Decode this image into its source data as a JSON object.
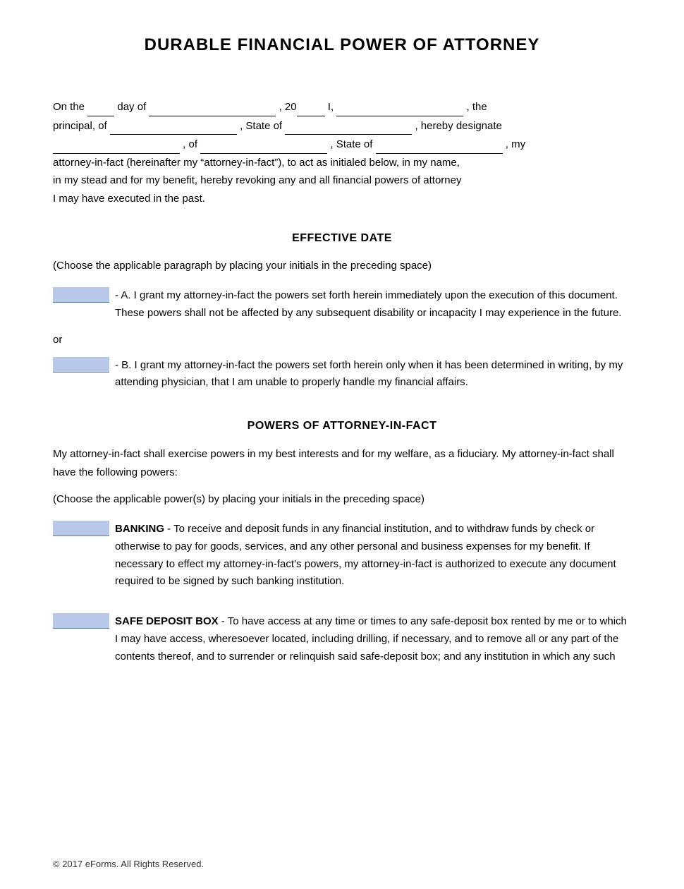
{
  "title": "DURABLE FINANCIAL POWER OF ATTORNEY",
  "intro": {
    "line1_pre": "On the",
    "day_field": "",
    "line1_mid1": "day of",
    "month_field": "",
    "line1_mid2": ", 20",
    "year_field": "",
    "line1_mid3": "I,",
    "name_field": "",
    "line1_end": ", the",
    "line2_pre": "principal, of",
    "address_field": "",
    "line2_mid": ", State of",
    "state1_field": "",
    "line2_end": ", hereby designate",
    "line3_name_field": "",
    "line3_mid1": ", of",
    "line3_address_field": "",
    "line3_mid2": ", State of",
    "line3_state_field": "",
    "line3_end": ", my",
    "line4": "attorney-in-fact (hereinafter my “attorney-in-fact”), to act as initialed below, in my name,",
    "line5": "in my stead and for my benefit, hereby revoking any and all financial powers of attorney",
    "line6": "I may have executed in the past."
  },
  "effective_date": {
    "section_title": "EFFECTIVE DATE",
    "choose_note": "(Choose the applicable paragraph by placing your initials in the preceding space)",
    "option_a": {
      "initials_label": "",
      "text": "- A. I grant my attorney-in-fact the powers set forth herein immediately upon the execution of this document. These powers shall not be affected by any subsequent disability or incapacity I may experience in the future."
    },
    "or_text": "or",
    "option_b": {
      "initials_label": "",
      "text": "- B. I grant my attorney-in-fact the powers set forth herein only when it has been determined in writing, by my attending physician, that I am unable to properly handle my financial affairs."
    }
  },
  "powers_of_attorney": {
    "section_title": "POWERS OF ATTORNEY-IN-FACT",
    "intro1": "My attorney-in-fact shall exercise powers in my best interests and for my welfare, as a fiduciary. My attorney-in-fact shall have the following powers:",
    "choose_note": "(Choose the applicable power(s) by placing your initials in the preceding space)",
    "banking": {
      "initials_label": "",
      "bold_label": "BANKING",
      "text": "- To receive and deposit funds in any financial institution, and to withdraw funds by check or otherwise to pay for goods, services, and any other personal and business expenses for my benefit.  If necessary to effect my attorney-in-fact’s powers, my attorney-in-fact is authorized to execute any document required to be signed by such banking institution."
    },
    "safe_deposit": {
      "initials_label": "",
      "bold_label": "SAFE DEPOSIT BOX",
      "text": "- To have access at any time or times to any safe-deposit box rented by me or to which I may have access, wheresoever located, including drilling, if necessary, and to remove all or any part of the contents thereof, and to surrender or relinquish said safe-deposit box; and any institution in which any such"
    }
  },
  "footer": {
    "copyright": "© 2017 eForms. All Rights Reserved."
  }
}
